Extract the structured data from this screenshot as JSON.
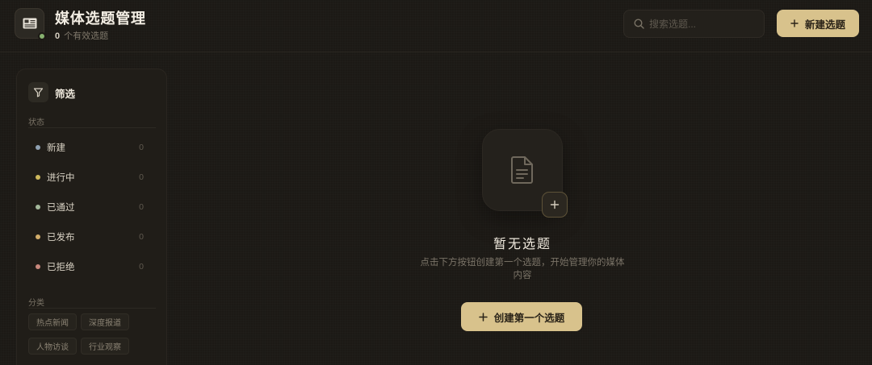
{
  "app": {
    "title": "媒体选题管理",
    "count": "0",
    "count_suffix": "个有效选题",
    "logo_icon": "newspaper-icon"
  },
  "header": {
    "search": {
      "icon": "search-icon",
      "placeholder": "搜索选题...",
      "value": ""
    },
    "new_button": {
      "icon": "plus-icon",
      "label": "新建选题"
    }
  },
  "sidebar": {
    "filter": {
      "icon": "filter-icon",
      "title": "筛选"
    },
    "status": {
      "label": "状态",
      "items": [
        {
          "label": "新建",
          "count": "0",
          "color": "#8fa1b2"
        },
        {
          "label": "进行中",
          "count": "0",
          "color": "#cdb85c"
        },
        {
          "label": "已通过",
          "count": "0",
          "color": "#a3b89a"
        },
        {
          "label": "已发布",
          "count": "0",
          "color": "#d2ad6a"
        },
        {
          "label": "已拒绝",
          "count": "0",
          "color": "#c8887c"
        }
      ]
    },
    "category": {
      "label": "分类",
      "tags": [
        "热点新闻",
        "深度报道",
        "人物访谈",
        "行业观察"
      ]
    }
  },
  "empty_state": {
    "icon": "document-icon",
    "badge_icon": "plus-icon",
    "title": "暂无选题",
    "description": "点击下方按钮创建第一个选题，开始管理你的媒体内容",
    "button": {
      "icon": "plus-icon",
      "label": "创建第一个选题"
    }
  },
  "colors": {
    "background": "#1c1915",
    "panel": "#201d18",
    "accent": "#d8c28c",
    "accent_text": "#2a2318",
    "online_dot": "#86b06f",
    "text_primary": "#efe9dd",
    "text_muted": "#7c7569"
  }
}
